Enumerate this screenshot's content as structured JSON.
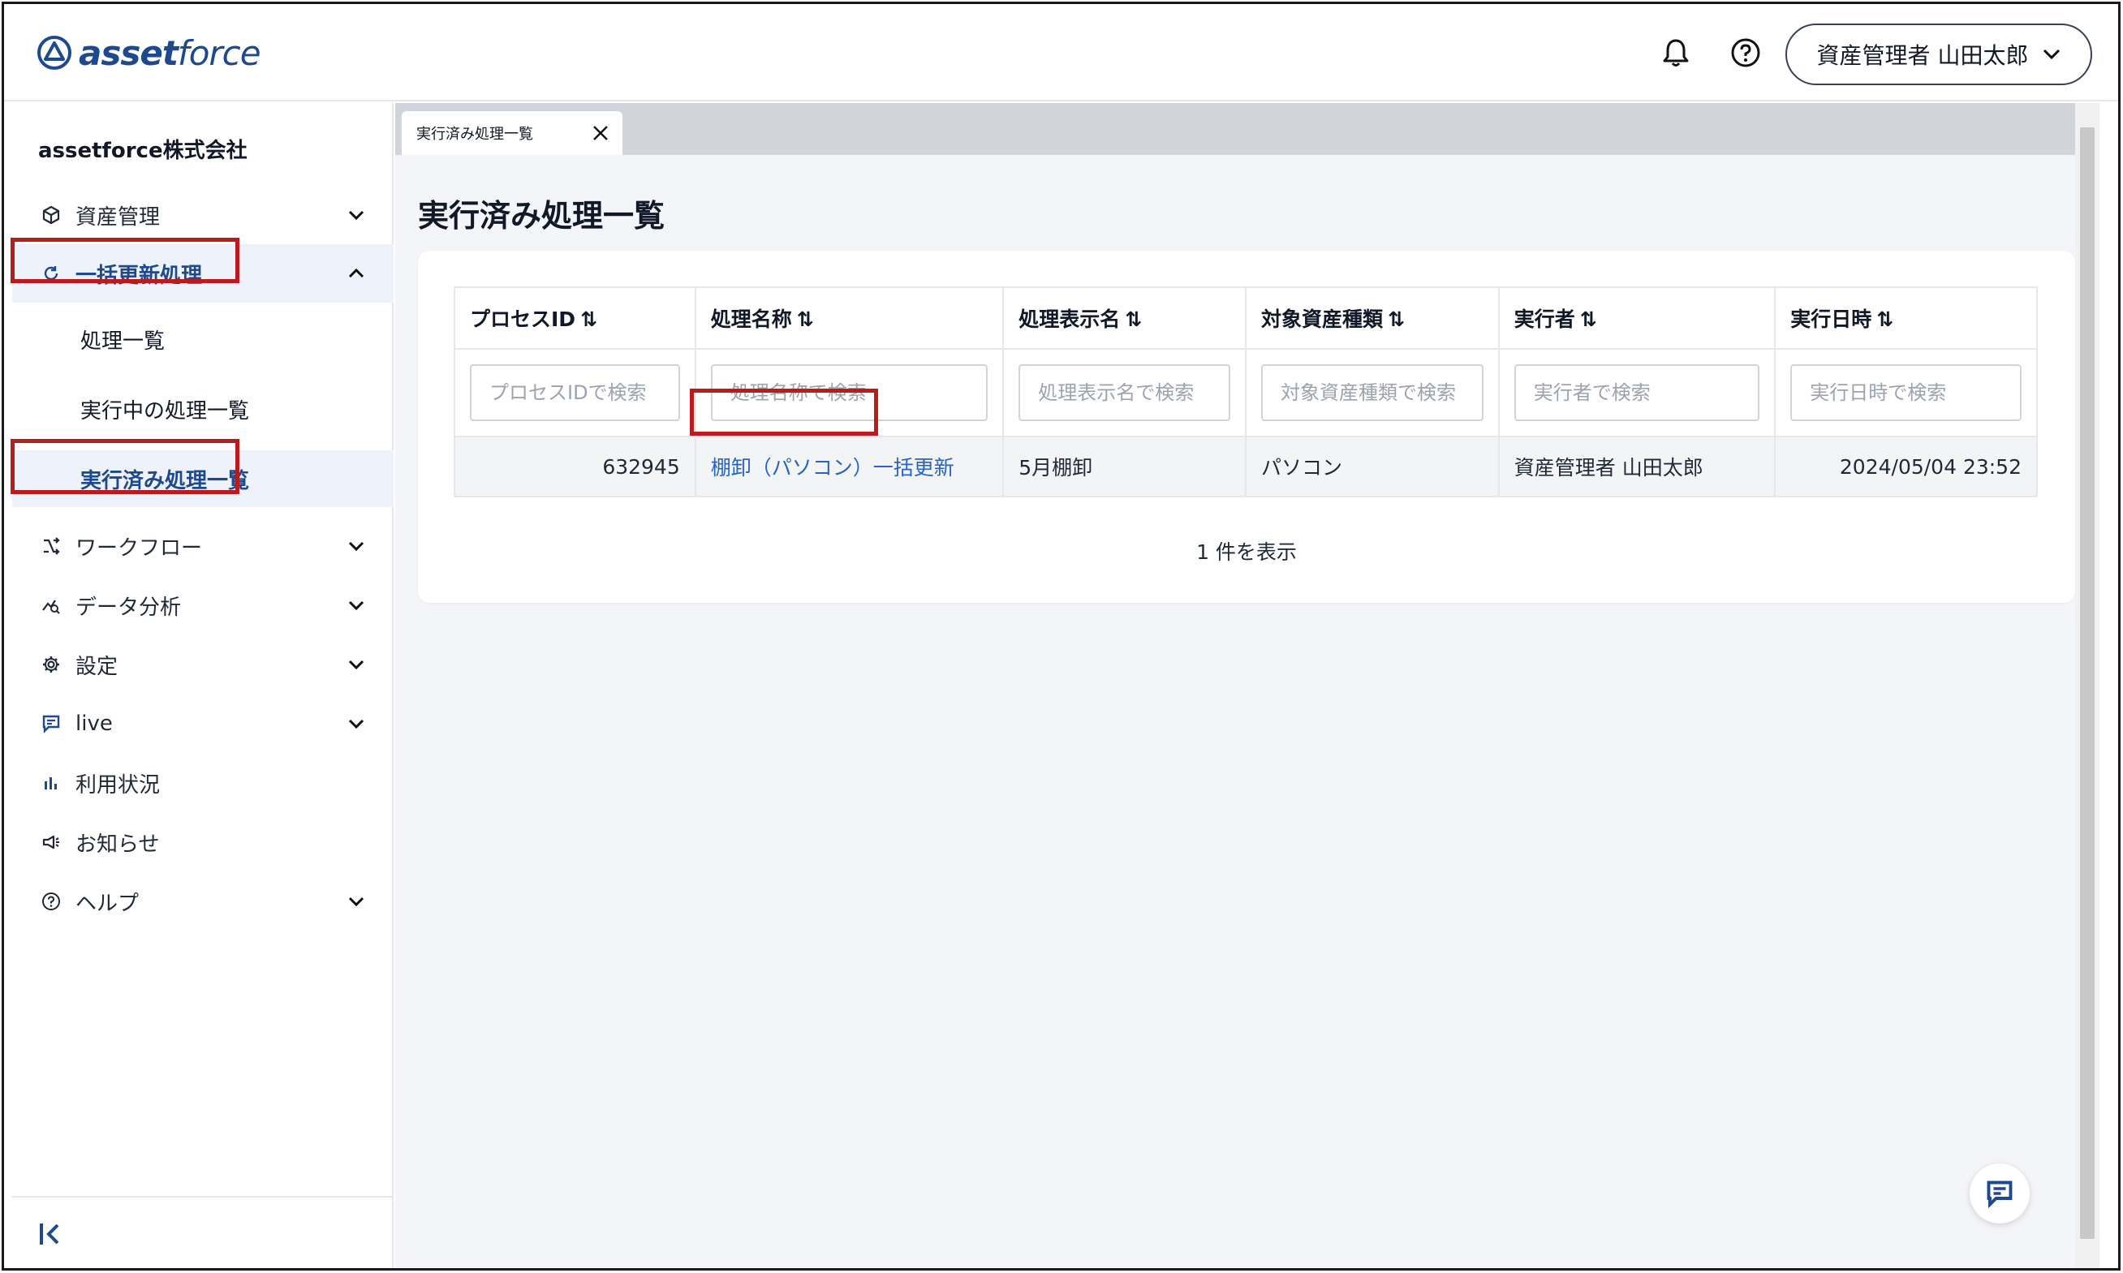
{
  "header": {
    "logo_bold": "asset",
    "logo_light": "force",
    "bell_icon": "bell-icon",
    "help_icon": "help-circle-icon",
    "user_label": "資産管理者 山田太郎"
  },
  "sidebar": {
    "company": "assetforce株式会社",
    "items": [
      {
        "label": "資産管理",
        "icon": "cube-icon"
      },
      {
        "label": "一括更新処理",
        "icon": "refresh-icon"
      },
      {
        "label": "ワークフロー",
        "icon": "workflow-icon"
      },
      {
        "label": "データ分析",
        "icon": "analytics-icon"
      },
      {
        "label": "設定",
        "icon": "gear-icon"
      },
      {
        "label": "live",
        "icon": "chat-icon"
      },
      {
        "label": "利用状況",
        "icon": "bar-chart-icon"
      },
      {
        "label": "お知らせ",
        "icon": "megaphone-icon"
      },
      {
        "label": "ヘルプ",
        "icon": "help-circle-icon"
      }
    ],
    "sub_items": [
      {
        "label": "処理一覧"
      },
      {
        "label": "実行中の処理一覧"
      },
      {
        "label": "実行済み処理一覧"
      }
    ]
  },
  "tab": {
    "label": "実行済み処理一覧"
  },
  "page": {
    "title": "実行済み処理一覧"
  },
  "table": {
    "columns": [
      {
        "label": "プロセスID",
        "placeholder": "プロセスIDで検索"
      },
      {
        "label": "処理名称",
        "placeholder": "処理名称で検索"
      },
      {
        "label": "処理表示名",
        "placeholder": "処理表示名で検索"
      },
      {
        "label": "対象資産種類",
        "placeholder": "対象資産種類で検索"
      },
      {
        "label": "実行者",
        "placeholder": "実行者で検索"
      },
      {
        "label": "実行日時",
        "placeholder": "実行日時で検索"
      }
    ],
    "sort_glyph": "⇅",
    "rows": [
      {
        "process_id": "632945",
        "name": "棚卸（パソコン）一括更新",
        "display_name": "5月棚卸",
        "asset_type": "パソコン",
        "executor": "資産管理者 山田太郎",
        "executed_at": "2024/05/04 23:52"
      }
    ],
    "count_text": "1 件を表示"
  },
  "colors": {
    "brand": "#1d4a8f",
    "link": "#2563c9",
    "highlight": "#b91c1c",
    "active_bg": "#eef3fb"
  }
}
